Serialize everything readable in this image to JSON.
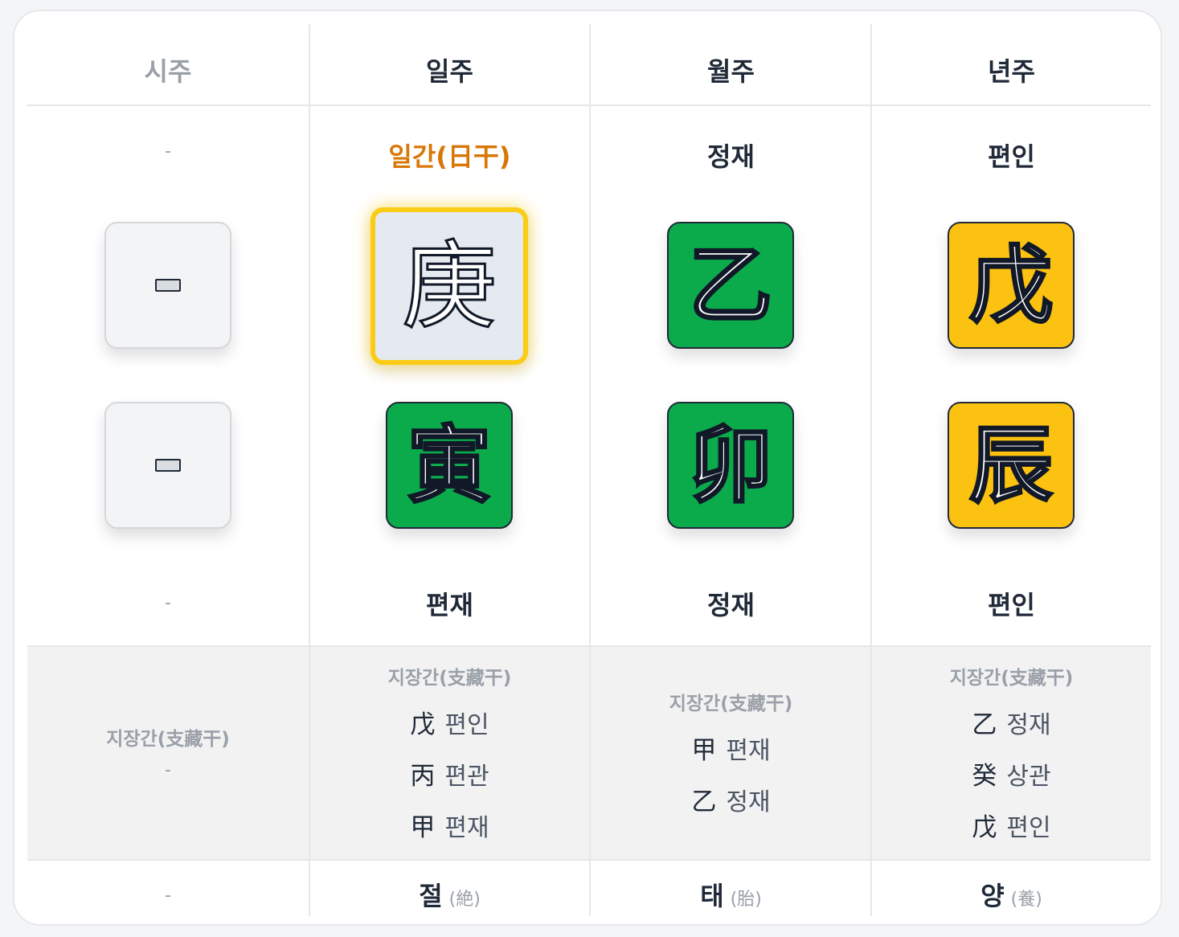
{
  "columns": [
    {
      "header": "시주",
      "stem_god": "-",
      "stem": "",
      "branch": "",
      "branch_god": "-",
      "hidden_title": "지장간(支藏干)",
      "hidden_empty": "-",
      "hidden": [],
      "stage": "-",
      "stage_hanja": ""
    },
    {
      "header": "일주",
      "stem_god": "일간(日干)",
      "stem": "庚",
      "branch": "寅",
      "branch_god": "편재",
      "hidden_title": "지장간(支藏干)",
      "hidden": [
        {
          "hanja": "戊",
          "god": "편인"
        },
        {
          "hanja": "丙",
          "god": "편관"
        },
        {
          "hanja": "甲",
          "god": "편재"
        }
      ],
      "stage": "절",
      "stage_hanja": "(絶)"
    },
    {
      "header": "월주",
      "stem_god": "정재",
      "stem": "乙",
      "branch": "卯",
      "branch_god": "정재",
      "hidden_title": "지장간(支藏干)",
      "hidden": [
        {
          "hanja": "甲",
          "god": "편재"
        },
        {
          "hanja": "乙",
          "god": "정재"
        }
      ],
      "stage": "태",
      "stage_hanja": "(胎)"
    },
    {
      "header": "년주",
      "stem_god": "편인",
      "stem": "戊",
      "branch": "辰",
      "branch_god": "편인",
      "hidden_title": "지장간(支藏干)",
      "hidden": [
        {
          "hanja": "乙",
          "god": "정재"
        },
        {
          "hanja": "癸",
          "god": "상관"
        },
        {
          "hanja": "戊",
          "god": "편인"
        }
      ],
      "stage": "양",
      "stage_hanja": "(養)"
    }
  ],
  "colors": {
    "wood": "#0bab4c",
    "earth": "#fcc211",
    "day_master_border": "#facc15",
    "accent_text": "#d97706"
  }
}
